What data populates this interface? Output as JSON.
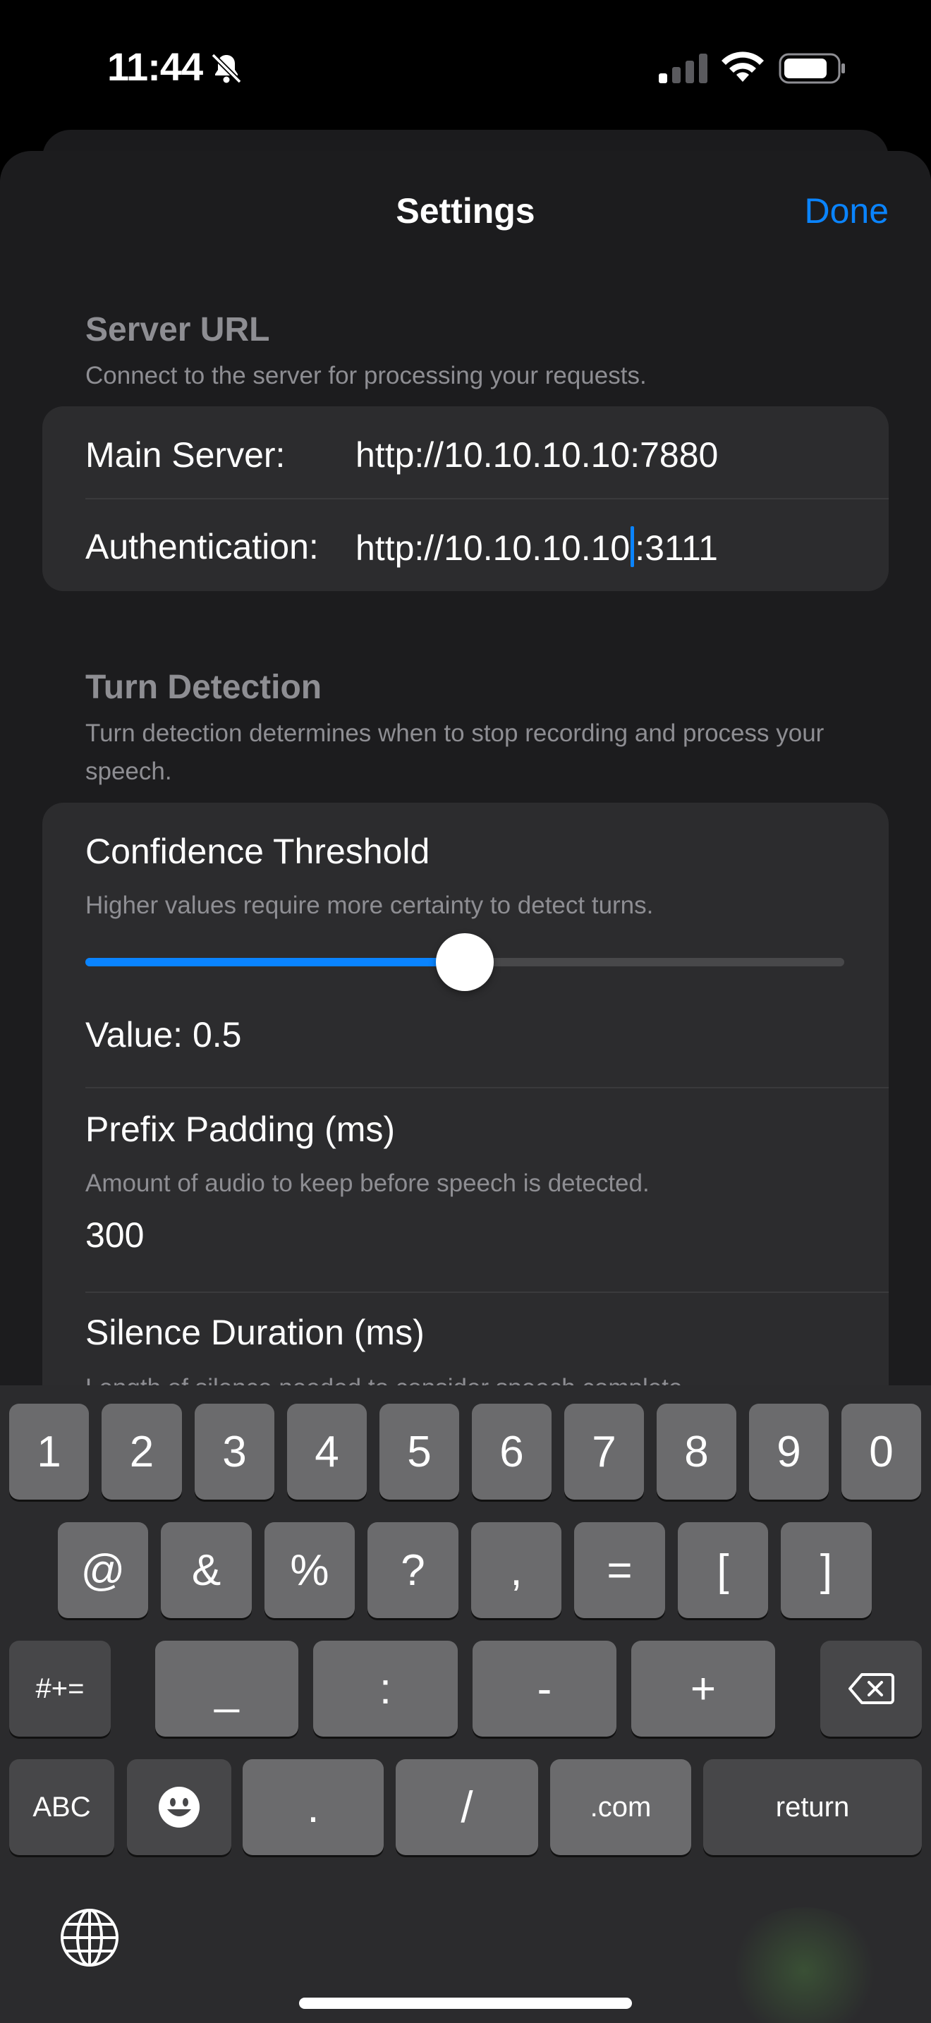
{
  "status_bar": {
    "time": "11:44",
    "icons": [
      "bell-slash-icon",
      "cellular-signal-icon",
      "wifi-icon",
      "battery-icon"
    ]
  },
  "nav": {
    "title": "Settings",
    "done_label": "Done",
    "accent_color": "#0a84ff"
  },
  "server_section": {
    "header": "Server URL",
    "description": "Connect to the server for processing your requests.",
    "rows": [
      {
        "label": "Main Server:",
        "value": "http://10.10.10.10:7880"
      },
      {
        "label": "Authentication:",
        "value_before_cursor": "http://10.10.10.10",
        "value_after_cursor": ":3111"
      }
    ]
  },
  "turn_section": {
    "header": "Turn Detection",
    "description": "Turn detection determines when to stop recording and process your speech.",
    "confidence": {
      "title": "Confidence Threshold",
      "description": "Higher values require more certainty to detect turns.",
      "slider_fraction": 0.5,
      "value_text": "Value: 0.5"
    },
    "prefix": {
      "title": "Prefix Padding (ms)",
      "description": "Amount of audio to keep before speech is detected.",
      "value": "300"
    },
    "silence": {
      "title": "Silence Duration (ms)",
      "description": "Length of silence needed to consider speech complete."
    }
  },
  "keyboard": {
    "row1": [
      "1",
      "2",
      "3",
      "4",
      "5",
      "6",
      "7",
      "8",
      "9",
      "0"
    ],
    "row2": [
      "@",
      "&",
      "%",
      "?",
      ",",
      "=",
      "[",
      "]"
    ],
    "row3_toggle": "#+=",
    "row3": [
      "_",
      ":",
      "-",
      "+"
    ],
    "row4": {
      "abc": "ABC",
      "dot": ".",
      "slash": "/",
      "dotcom": ".com",
      "return": "return"
    },
    "icons": [
      "delete-icon",
      "emoji-icon",
      "globe-icon"
    ]
  }
}
